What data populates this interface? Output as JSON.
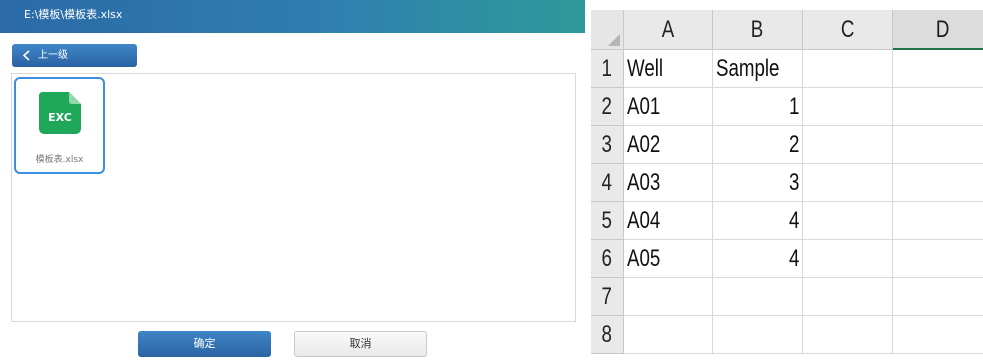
{
  "dialog": {
    "title": "E:\\模板\\模板表.xlsx",
    "back_label": "上一级",
    "file": {
      "name": "模板表.xlsx",
      "icon_text": "EXC",
      "icon": "excel-file-icon",
      "icon_color": "#1fa75a"
    },
    "ok_label": "确定",
    "cancel_label": "取消"
  },
  "sheet": {
    "columns": [
      "A",
      "B",
      "C",
      "D"
    ],
    "rows": [
      "1",
      "2",
      "3",
      "4",
      "5",
      "6",
      "7",
      "8"
    ],
    "cells": [
      [
        "Well",
        "Sample",
        "",
        ""
      ],
      [
        "A01",
        "1",
        "",
        ""
      ],
      [
        "A02",
        "2",
        "",
        ""
      ],
      [
        "A03",
        "3",
        "",
        ""
      ],
      [
        "A04",
        "4",
        "",
        ""
      ],
      [
        "A05",
        "4",
        "",
        ""
      ],
      [
        "",
        "",
        "",
        ""
      ],
      [
        "",
        "",
        "",
        ""
      ]
    ]
  }
}
